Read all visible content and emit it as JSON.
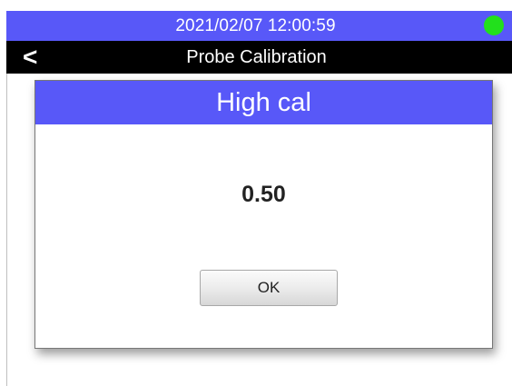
{
  "status_bar": {
    "datetime": "2021/02/07  12:00:59",
    "status_indicator": "green-circle",
    "colors": {
      "background": "#5858f8",
      "indicator": "#22e01c"
    }
  },
  "title_bar": {
    "back_label": "<",
    "title": "Probe Calibration",
    "colors": {
      "background": "#000000",
      "text": "#ffffff"
    }
  },
  "dialog": {
    "title": "High cal",
    "value": "0.50",
    "ok_label": "OK",
    "colors": {
      "header_background": "#5858f8",
      "header_text": "#ffffff"
    }
  }
}
